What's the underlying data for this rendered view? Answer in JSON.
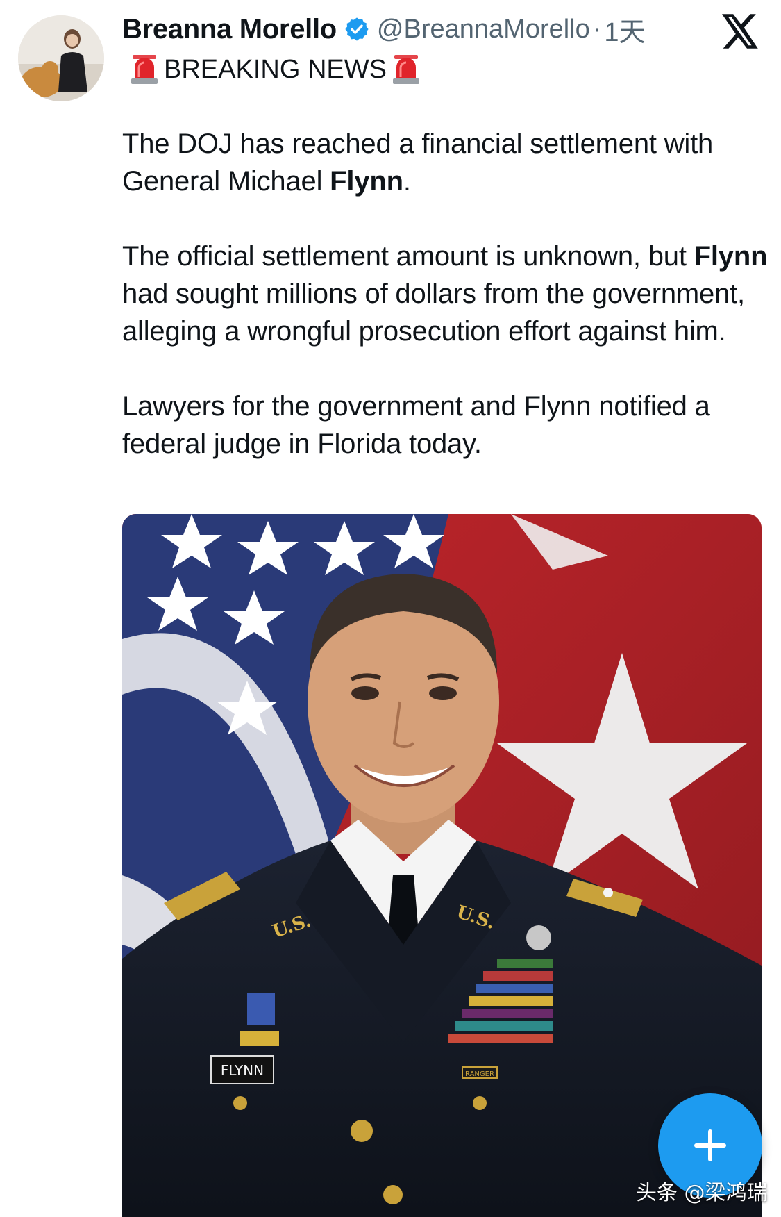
{
  "tweet": {
    "author_name": "Breanna Morello",
    "handle": "@BreannaMorello",
    "separator": "·",
    "time": "1天",
    "headline": "BREAKING NEWS",
    "paragraphs": [
      [
        {
          "text": "The DOJ has reached a financial settlement with General Michael ",
          "bold": false
        },
        {
          "text": "Flynn",
          "bold": true
        },
        {
          "text": ".",
          "bold": false
        }
      ],
      [
        {
          "text": "The official settlement amount is unknown, but ",
          "bold": false
        },
        {
          "text": "Flynn",
          "bold": true
        },
        {
          "text": " had sought millions of dollars from the government, alleging a wrongful prosecution effort against him.",
          "bold": false
        }
      ],
      [
        {
          "text": "Lawyers for the government and Flynn notified a federal judge in Florida today.",
          "bold": false
        }
      ]
    ],
    "photo": {
      "left_rank_insignia": "U.S.",
      "right_rank_insignia": "U.S.",
      "name_tag": "FLYNN",
      "tab": "RANGER"
    }
  },
  "icons": {
    "verified": "verified-badge-icon",
    "x_logo": "x-logo-icon",
    "siren": "siren-emoji-icon",
    "compose": "plus-icon"
  },
  "watermark": "头条 @梁鸿瑞",
  "colors": {
    "verified": "#1d9bf0",
    "fab": "#1d9bf0",
    "secondary_text": "#536471",
    "flag_red": "#b51f26",
    "flag_blue": "#2a3a78"
  }
}
